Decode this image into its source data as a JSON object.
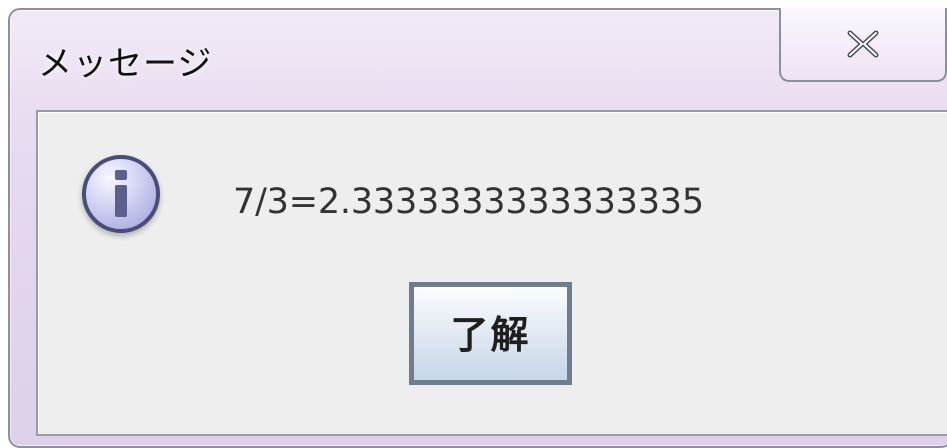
{
  "dialog": {
    "title": "メッセージ",
    "message": "7/3=2.3333333333333335",
    "ok_label": "了解",
    "icons": {
      "info": "information-icon",
      "close": "close-icon"
    },
    "colors": {
      "title_bar": "#e6dbef",
      "panel": "#eeeeee",
      "border": "#8f8f9b",
      "info_icon": "#c7c7ef",
      "button_border": "#6f7d8e"
    }
  }
}
